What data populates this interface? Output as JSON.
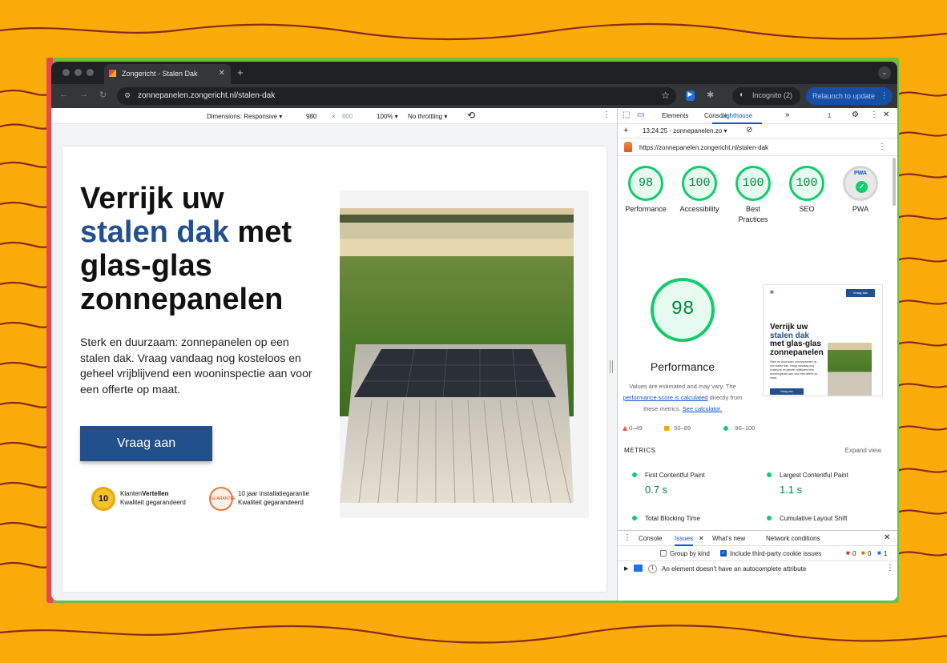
{
  "colors": {
    "background": "#f9ab09",
    "brand_blue": "#22508c",
    "lh_green": "#0cce6b",
    "devtools_blue": "#0b57d0"
  },
  "browser": {
    "tab_title": "Zongericht - Stalen Dak",
    "url": "zonnepanelen.zongericht.nl/stalen-dak",
    "incognito_label": "Incognito (2)",
    "relaunch_label": "Relaunch to update"
  },
  "device_toolbar": {
    "dimensions_label": "Dimensions: Responsive ▾",
    "width": "980",
    "times": "×",
    "height": "800",
    "zoom": "100% ▾",
    "throttle": "No throttling ▾"
  },
  "page": {
    "heading_line1": "Verrijk uw",
    "heading_blue": "stalen dak",
    "heading_after_blue": " met",
    "heading_line3": "glas-glas",
    "heading_line4": "zonnepanelen",
    "lead": "Sterk en duurzaam: zonnepanelen op een stalen dak. Vraag vandaag nog kosteloos en geheel vrijblijvend een wooninspectie aan voor een offerte op maat.",
    "cta": "Vraag aan",
    "badge1": {
      "score": "10",
      "name_light": "Klanten",
      "name_bold": "Vertellen",
      "sub": "Kwaliteit gegarandeerd"
    },
    "badge2": {
      "seal": "GUARANTEE",
      "title": "10 jaar installatiegarantie",
      "sub": "Kwaliteit gegarandeerd"
    }
  },
  "devtools": {
    "tabs": [
      "Elements",
      "Console",
      "Lighthouse"
    ],
    "more": "»",
    "issue_count": "1",
    "report_time": "13:24:25 - zonnepanelen.zo ▾",
    "report_url": "https://zonnepanelen.zongericht.nl/stalen-dak",
    "scores": [
      {
        "value": "98",
        "label": "Performance"
      },
      {
        "value": "100",
        "label": "Accessibility"
      },
      {
        "value": "100",
        "label": "Best Practices"
      },
      {
        "value": "100",
        "label": "SEO"
      }
    ],
    "pwa": {
      "badge": "PWA",
      "label": "PWA"
    },
    "performance": {
      "score": "98",
      "label": "Performance",
      "note_before": "Values are estimated and may vary. The ",
      "note_link": "performance score is calculated",
      "note_mid": " directly from these metrics. ",
      "note_link2": "See calculator.",
      "legend": [
        "0–49",
        "50–89",
        "90–100"
      ]
    },
    "thumbnail": {
      "cta": "Vraag aan",
      "heading_line1": "Verrijk uw",
      "heading_blue": "stalen dak",
      "heading_line3": "met glas-glas",
      "heading_line4": "zonnepanelen",
      "lead": "Sterk en duurzaam: zonnepanelen op een stalen dak. Vraag vandaag nog kosteloos en geheel vrijblijvend een wooninspectie aan voor een offerte op maat.",
      "button": "Vraag aan"
    },
    "metrics": {
      "title": "METRICS",
      "expand": "Expand view",
      "items": [
        {
          "label": "First Contentful Paint",
          "value": "0.7 s"
        },
        {
          "label": "Largest Contentful Paint",
          "value": "1.1 s"
        },
        {
          "label": "Total Blocking Time",
          "value": ""
        },
        {
          "label": "Cumulative Layout Shift",
          "value": ""
        }
      ]
    },
    "drawer": {
      "tabs": [
        "Console",
        "Issues",
        "What's new",
        "Network conditions"
      ],
      "group_by_kind": "Group by kind",
      "third_party": "Include third-party cookie issues",
      "counts": {
        "errors": "0",
        "warnings": "0",
        "info": "1"
      },
      "issue_count": "1",
      "issue_text": "An element doesn't have an autocomplete attribute"
    }
  }
}
